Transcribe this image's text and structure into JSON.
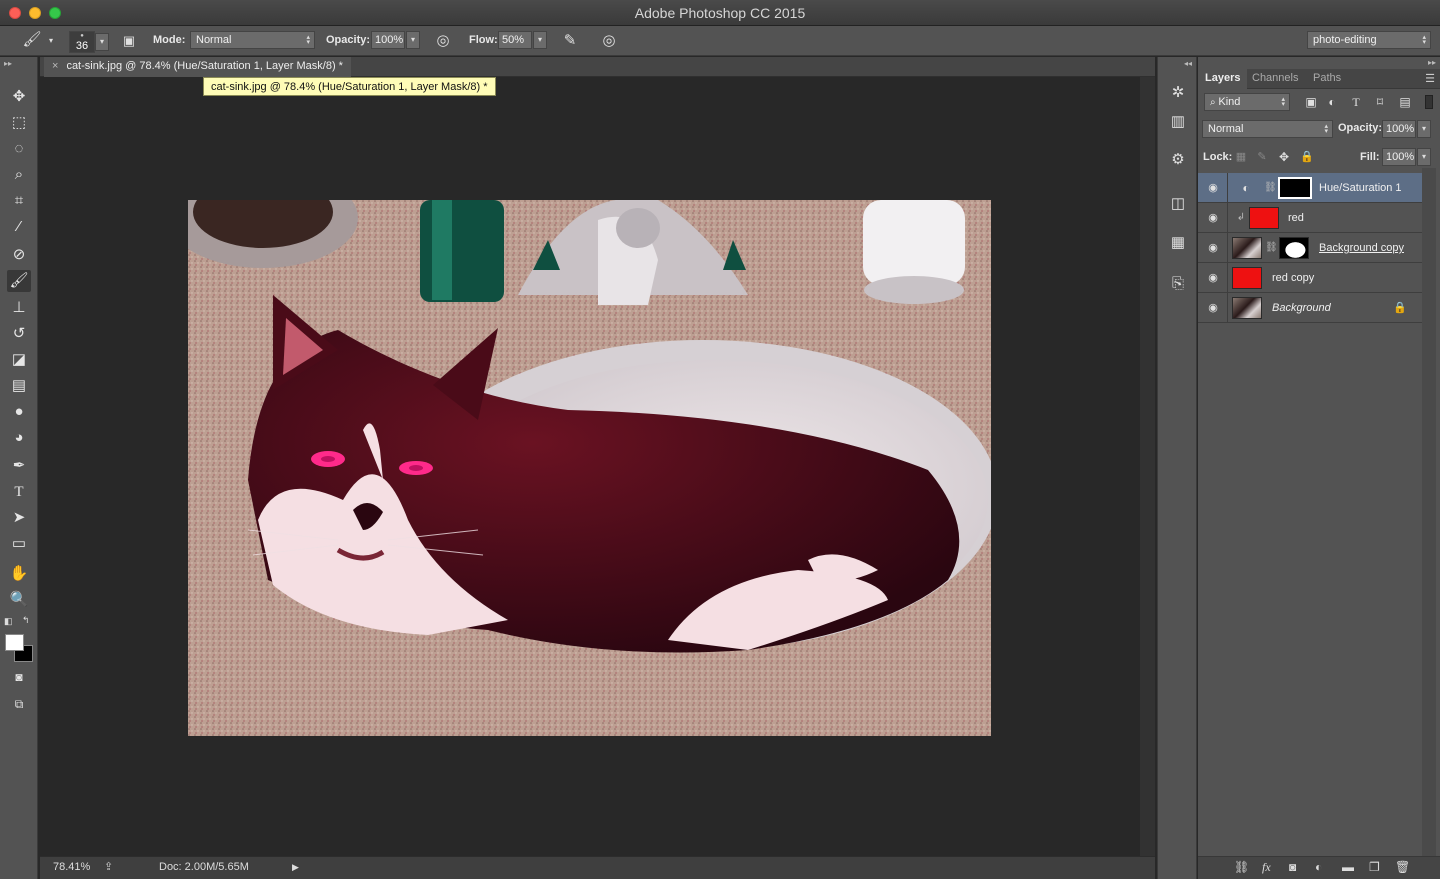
{
  "window": {
    "title": "Adobe Photoshop CC 2015"
  },
  "options": {
    "brush_size": "36",
    "mode_label": "Mode:",
    "mode_value": "Normal",
    "opacity_label": "Opacity:",
    "opacity_value": "100%",
    "flow_label": "Flow:",
    "flow_value": "50%",
    "workspace": "photo-editing"
  },
  "document": {
    "tab_title": "cat-sink.jpg @ 78.4% (Hue/Saturation 1, Layer Mask/8) *",
    "tooltip": "cat-sink.jpg @ 78.4% (Hue/Saturation 1, Layer Mask/8) *",
    "zoom": "78.41%",
    "doc_size": "Doc: 2.00M/5.65M"
  },
  "tools": [
    "move-tool",
    "marquee-tool",
    "lasso-tool",
    "quick-selection-tool",
    "crop-tool",
    "eyedropper-tool",
    "healing-brush-tool",
    "brush-tool",
    "clone-stamp-tool",
    "history-brush-tool",
    "eraser-tool",
    "gradient-tool",
    "blur-tool",
    "dodge-tool",
    "pen-tool",
    "type-tool",
    "path-selection-tool",
    "rectangle-tool",
    "hand-tool",
    "zoom-tool"
  ],
  "layers_panel": {
    "tabs": [
      "Layers",
      "Channels",
      "Paths"
    ],
    "kind_label": "Kind",
    "blend_mode": "Normal",
    "opacity_label": "Opacity:",
    "opacity_value": "100%",
    "lock_label": "Lock:",
    "fill_label": "Fill:",
    "fill_value": "100%",
    "layers": [
      {
        "name": "Hue/Saturation 1",
        "selected": true
      },
      {
        "name": "red",
        "selected": false
      },
      {
        "name": "Background copy",
        "selected": false
      },
      {
        "name": "red copy",
        "selected": false
      },
      {
        "name": "Background",
        "selected": false
      }
    ]
  },
  "colors": {
    "red_fill": "#ee1111",
    "selection": "#5d6e86",
    "panel": "#535353",
    "canvas": "#282828"
  }
}
